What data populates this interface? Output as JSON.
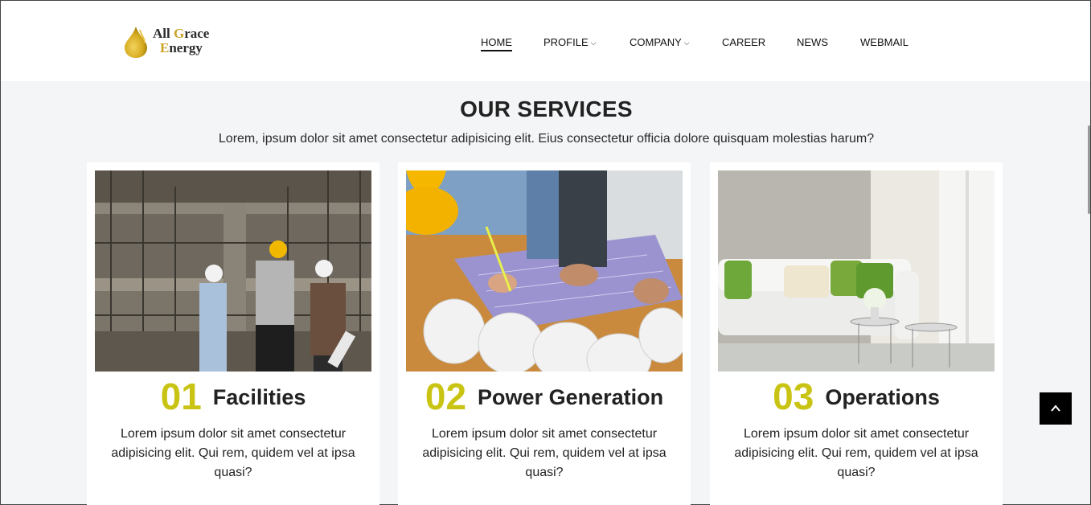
{
  "brand": {
    "line1_a": "All ",
    "line1_b": "G",
    "line1_c": "race",
    "line2_a": "E",
    "line2_b": "nergy"
  },
  "nav": {
    "home": "HOME",
    "profile": "PROFILE",
    "company": "COMPANY",
    "career": "CAREER",
    "news": "NEWS",
    "webmail": "WEBMAIL"
  },
  "services": {
    "title": "OUR SERVICES",
    "subtitle": "Lorem, ipsum dolor sit amet consectetur adipisicing elit. Eius consectetur officia dolore quisquam molestias harum?",
    "cards": [
      {
        "num": "01",
        "title": "Facilities",
        "text": "Lorem ipsum dolor sit amet consectetur adipisicing elit. Qui rem, quidem vel at ipsa quasi?"
      },
      {
        "num": "02",
        "title": "Power Generation",
        "text": "Lorem ipsum dolor sit amet consectetur adipisicing elit. Qui rem, quidem vel at ipsa quasi?"
      },
      {
        "num": "03",
        "title": "Operations",
        "text": "Lorem ipsum dolor sit amet consectetur adipisicing elit. Qui rem, quidem vel at ipsa quasi?"
      }
    ]
  },
  "icons": {
    "caret": "chevron-down-icon",
    "back_to_top": "chevron-up-icon",
    "logo": "oil-drop-icon"
  },
  "colors": {
    "accent": "#c9c414",
    "gold": "#c9a227",
    "dark": "#222222"
  }
}
